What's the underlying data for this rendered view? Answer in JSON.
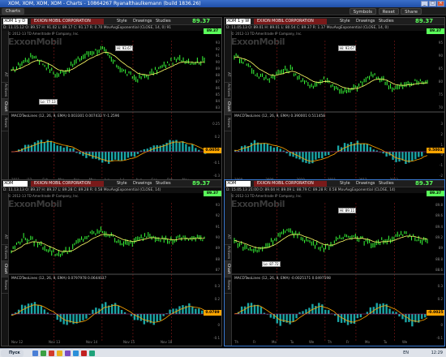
{
  "window": {
    "title": "XOM, XOM, XOM, XOM - Charts - 10864267 Ryanalthaulkemann (build 1836.26)"
  },
  "appbar": {
    "tab": "Charts",
    "buttons": [
      "Symbols",
      "Reset",
      "Share"
    ]
  },
  "panels": [
    {
      "symbol": "XOM 1 y D",
      "company": "EXXON MOBIL CORPORATION",
      "style": "Style",
      "drawings": "Drawings",
      "studies": "Studies",
      "price": "89.37",
      "info": "D: 11.15.12  O: 89.57  H: 91.02  L: 89.17  C: 91.17  R: 0.70   MovAvgExponential (CLOSE, 14, 0)  91",
      "copyright": "© 2012-13 TD Ameritrade IP Company, Inc.",
      "watermark": "ExxonMobil",
      "price_labels": [
        "93",
        "92",
        "91",
        "90",
        "89",
        "88",
        "87",
        "86",
        "85",
        "84",
        "83"
      ],
      "callout_high": "Hi: 93.67",
      "callout_low": "Lo: 77.13",
      "macd_label": "MACDTwoLines (12, 26, 9, EMA)  0.003301  0.007432   Y:-1.2596",
      "macd_tags": [
        "0.25",
        "0.2",
        "0.1",
        "-0.1",
        "-0.3"
      ],
      "macd_value": "0.0050",
      "price_tag": "89.37",
      "x_axis": [
        "2011",
        "'12",
        "Feb",
        "Mar",
        "Apr",
        "May",
        "Jun",
        "Jul",
        "Aug",
        "Sep",
        "Oct",
        "Nov"
      ],
      "tabs": [
        "AT",
        "Actives",
        "Chart",
        "News"
      ]
    },
    {
      "symbol": "XOM 1 y W",
      "company": "EXXON MOBIL CORPORATION",
      "style": "Style",
      "drawings": "Drawings",
      "studies": "Studies",
      "price": "89.37",
      "info": "D: 11.05.13  O: 89.01  H: 89.01  L: 80.54  C: 89.37  R: 1.17   MovAvgExponential (CLOSE, 14, 0)",
      "copyright": "© 2012-13 TD Ameritrade IP Company, Inc.",
      "watermark": "ExxonMobil",
      "price_labels": [
        "95",
        "90",
        "85",
        "80",
        "75",
        "70"
      ],
      "callout_high": "Hi: 93.67",
      "callout_low": "",
      "macd_label": "MACDTwoLines (12, 26, 9, EMA)  0.390001  0.511458",
      "macd_tags": [
        "3",
        "2",
        "1",
        "0",
        "-1",
        "-2"
      ],
      "macd_value": "0.5001",
      "price_tag": "89.37",
      "x_axis": [
        "2008",
        "2009",
        "2010",
        "2011",
        "2012",
        "2013"
      ],
      "tabs": [
        "AT",
        "Actives",
        "Chart",
        "News"
      ]
    },
    {
      "symbol": "XOM",
      "company": "EXXON MOBIL CORPORATION",
      "style": "Style",
      "drawings": "Drawings",
      "studies": "Studies",
      "price": "89.37",
      "info": "D: 11.13.13  O: 89.37  H: 89.37  L: 89.28  C: 89.28  R: 0.58   MovAvgExponential (CLOSE, 14)",
      "copyright": "© 2012-13 TD Ameritrade IP Company, Inc.",
      "watermark": "ExxonMobil",
      "price_labels": [
        "93",
        "92",
        "91",
        "90",
        "89",
        "88",
        "87"
      ],
      "callout_high": "",
      "callout_low": "",
      "macd_label": "MACDTwoLines (12, 26, 9, EMA)  0.0797978  0.0644037",
      "macd_tags": [
        "0.3",
        "0.2",
        "0.1",
        "0",
        "-0.1"
      ],
      "macd_value": "0.0789",
      "price_tag": "89.37",
      "x_axis": [
        "Nov 12",
        "Nov 13",
        "Nov 14",
        "Nov 15",
        "Nov 18"
      ],
      "tabs": [
        "AT",
        "Actives",
        "Chart",
        "News"
      ]
    },
    {
      "symbol": "XOM",
      "company": "EXXON MOBIL CORPORATION",
      "style": "Style",
      "drawings": "Drawings",
      "studies": "Studies",
      "price": "89.37",
      "info": "D: 15.05.13 21:00  O: 89.04  H: 89.09  L: 88.79  C: 89.28  R: 0.58   MovAvgExponential (CLOSE, 14)",
      "copyright": "© 2012-13 TD Ameritrade IP Company, Inc.",
      "watermark": "ExxonMobil",
      "price_labels": [
        "89.8",
        "89.6",
        "89.4",
        "89.2",
        "89",
        "88.8",
        "88.6"
      ],
      "callout_high": "Hi: 89.11",
      "callout_low": "Lo: 87.72",
      "macd_label": "MACDTwoLines (12, 26, 9, EMA)  -0.0025171  0.0497598",
      "macd_tags": [
        "0.3",
        "0.2",
        "0.1",
        "0",
        "-0.1"
      ],
      "macd_value": "-0.0025",
      "price_tag": "89.37",
      "x_axis": [
        "Th",
        "Fr",
        "Mo",
        "Tu",
        "We",
        "Th",
        "Fr",
        "Mo",
        "Tu",
        "We"
      ],
      "tabs": [
        "AT",
        "Actives",
        "Chart",
        "News"
      ]
    }
  ],
  "taskbar": {
    "start": "Пуск",
    "lang": "EN",
    "clock": "12:29"
  },
  "colors": {
    "price_line": "#39ff39",
    "ema": "#ffff66",
    "macd_bar": "#1aa6a6",
    "signal": "#ffa500",
    "price_tag": "#5bff5b"
  }
}
